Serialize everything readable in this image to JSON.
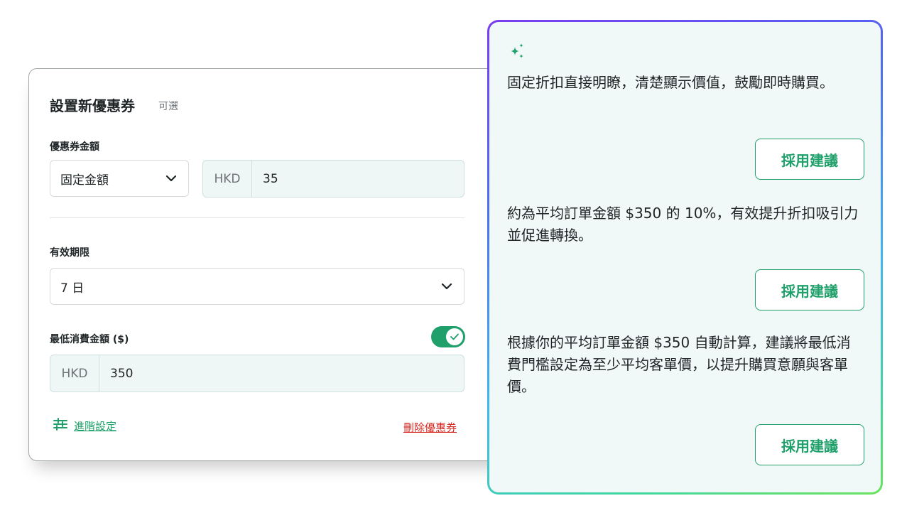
{
  "coupon": {
    "title": "設置新優惠券",
    "optional_label": "可選",
    "amount_label": "優惠券金額",
    "amount_type": "固定金額",
    "currency_prefix": "HKD",
    "amount_value": "35",
    "validity_label": "有效期限",
    "validity_value": "7 日",
    "min_spend_label": "最低消費金額 ($)",
    "min_spend_enabled": true,
    "min_spend_prefix": "HKD",
    "min_spend_value": "350",
    "advanced_label": "進階設定",
    "delete_label": "刪除優惠券"
  },
  "ai": {
    "suggestions": [
      {
        "text": "固定折扣直接明瞭，清楚顯示價值，鼓勵即時購買。",
        "button": "採用建議"
      },
      {
        "text": "約為平均訂單金額 $350 的 10%，有效提升折扣吸引力並促進轉換。",
        "button": "採用建議"
      },
      {
        "text": "根據你的平均訂單金額 $350 自動計算，建議將最低消費門檻設定為至少平均客單價，以提升購買意願與客單價。",
        "button": "採用建議"
      }
    ]
  },
  "colors": {
    "accent": "#1fa06a",
    "danger": "#d5261f",
    "panel_bg": "#f1f9f8",
    "input_bg": "#eef7f6"
  },
  "icons": {
    "sparkle": "sparkle-icon",
    "chevron": "chevron-down-icon",
    "check": "check-icon",
    "settings": "sliders-icon"
  }
}
